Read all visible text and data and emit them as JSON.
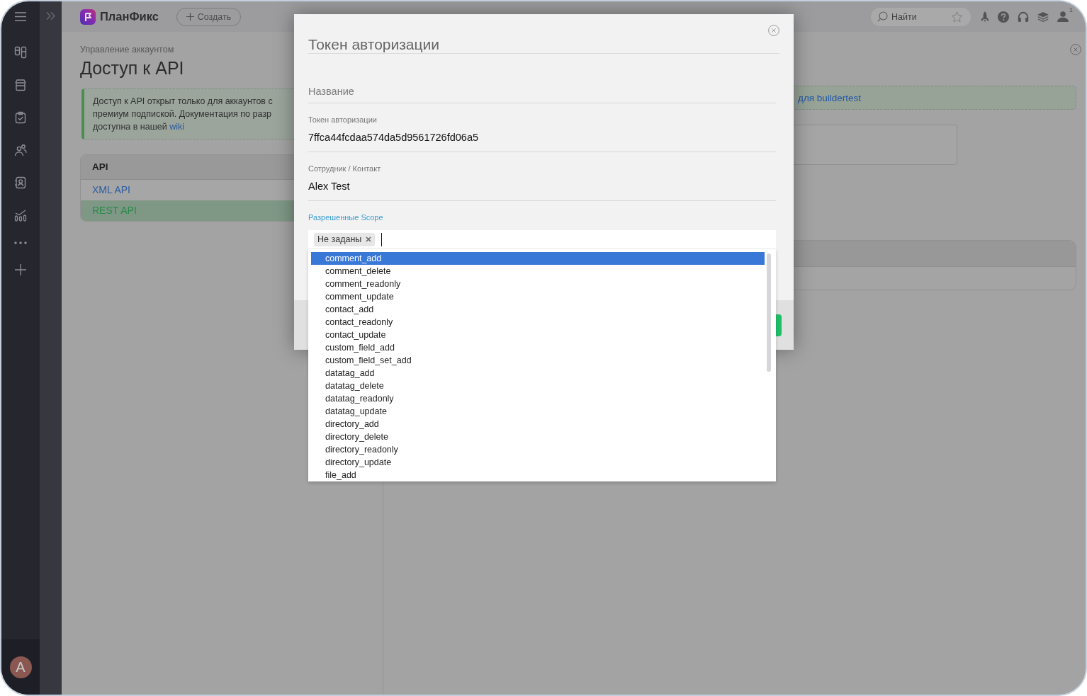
{
  "sidebar": {
    "avatar_letter": "A"
  },
  "top_bar": {
    "brand": "ПланФикс",
    "create_button": "Создать",
    "search": {
      "placeholder": "Найти"
    },
    "profile_count": "1"
  },
  "page": {
    "breadcrumb": "Управление аккаунтом",
    "title": "Доступ к API",
    "notice": {
      "lines": [
        "Доступ к API открыт только для аккаунтов с",
        "премиум подпиской. Документация по разр",
        "доступна в нашей"
      ],
      "link": "wiki"
    },
    "api_list": {
      "header": "API",
      "items": [
        {
          "label": "XML API",
          "selected": false
        },
        {
          "label": "REST API",
          "selected": true
        }
      ]
    },
    "right_panel": {
      "notice_link": "для buildertest"
    }
  },
  "modal": {
    "title": "Токен авторизации",
    "name_field": {
      "placeholder": "Название"
    },
    "token_field": {
      "label": "Токен авторизации",
      "value": "7ffca44fcdaa574da5d9561726fd06a5"
    },
    "employee_field": {
      "label": "Сотрудник / Контакт",
      "value": "Alex Test"
    },
    "scope_field": {
      "label": "Разрешенные Scope",
      "tags": [
        "Не заданы"
      ],
      "options": [
        {
          "label": "comment_add",
          "selected": true
        },
        {
          "label": "comment_delete",
          "selected": false
        },
        {
          "label": "comment_readonly",
          "selected": false
        },
        {
          "label": "comment_update",
          "selected": false
        },
        {
          "label": "contact_add",
          "selected": false
        },
        {
          "label": "contact_readonly",
          "selected": false
        },
        {
          "label": "contact_update",
          "selected": false
        },
        {
          "label": "custom_field_add",
          "selected": false
        },
        {
          "label": "custom_field_set_add",
          "selected": false
        },
        {
          "label": "datatag_add",
          "selected": false
        },
        {
          "label": "datatag_delete",
          "selected": false
        },
        {
          "label": "datatag_readonly",
          "selected": false
        },
        {
          "label": "datatag_update",
          "selected": false
        },
        {
          "label": "directory_add",
          "selected": false
        },
        {
          "label": "directory_delete",
          "selected": false
        },
        {
          "label": "directory_readonly",
          "selected": false
        },
        {
          "label": "directory_update",
          "selected": false
        },
        {
          "label": "file_add",
          "selected": false
        }
      ]
    }
  }
}
